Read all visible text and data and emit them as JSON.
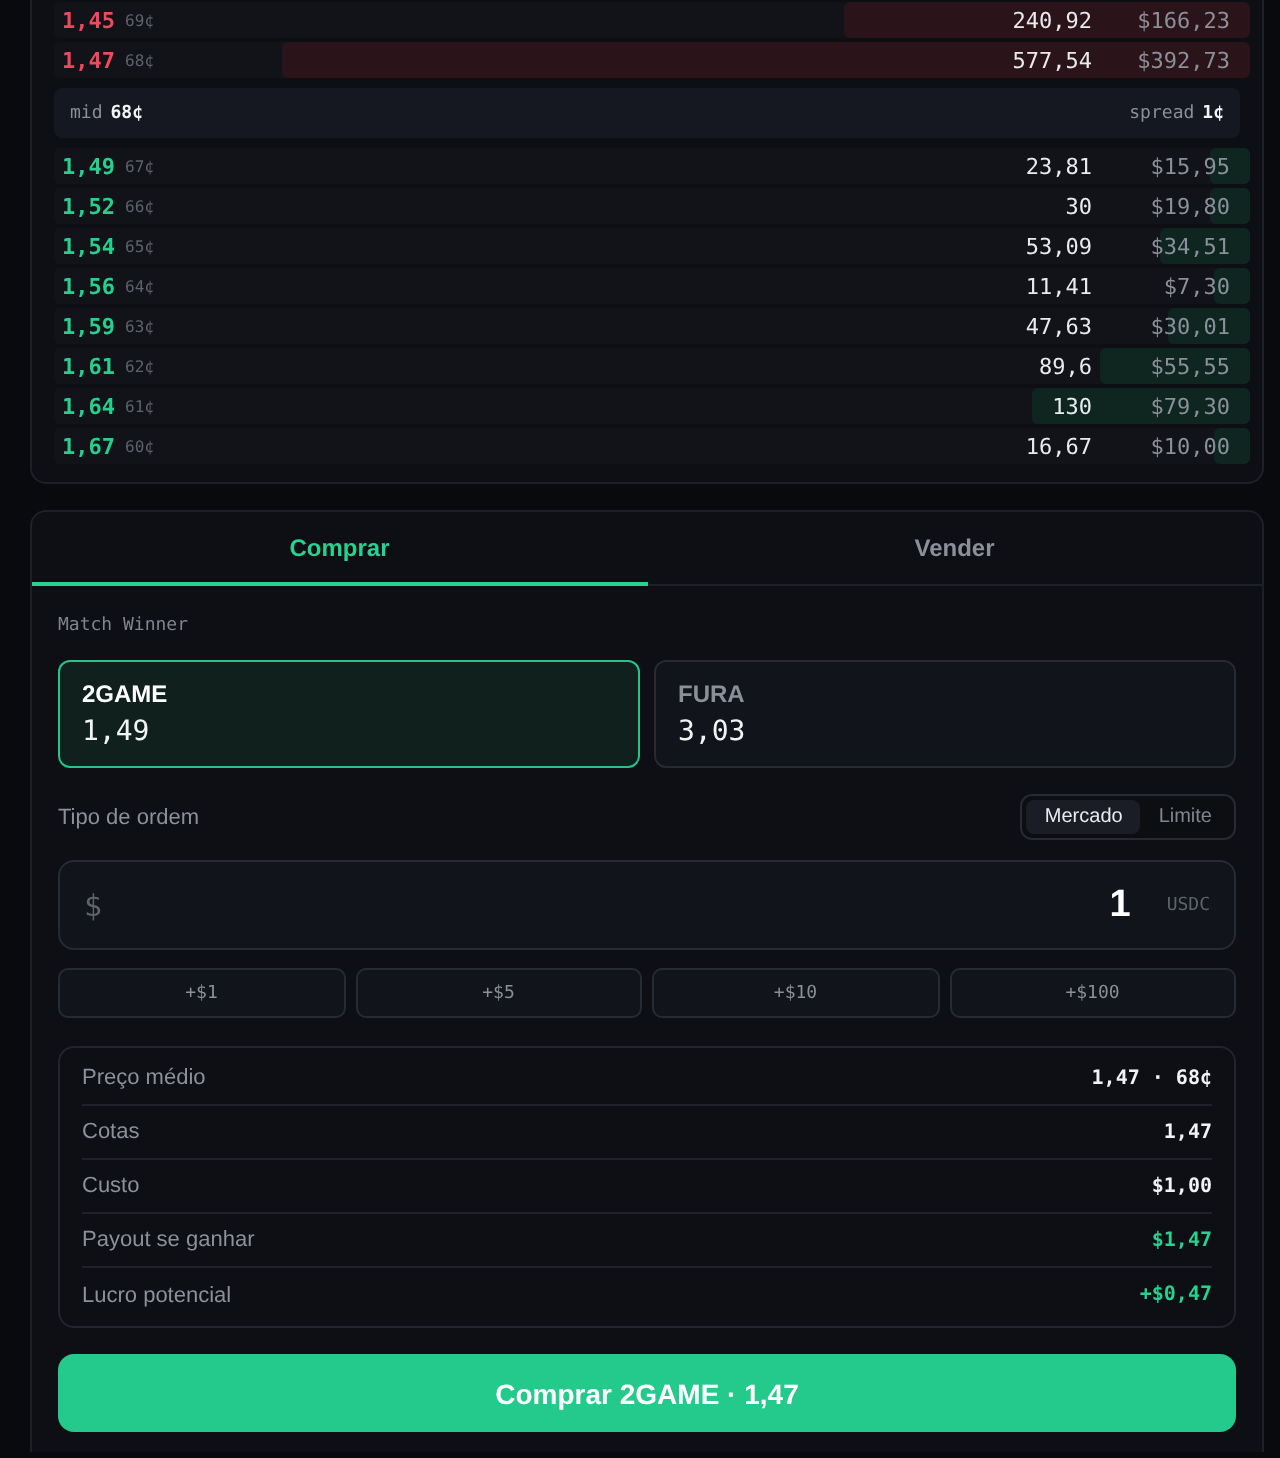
{
  "order_book": {
    "asks": [
      {
        "price": "1,45",
        "cents": "69¢",
        "shares": "240,92",
        "value": "$166,23",
        "level": 0.34
      },
      {
        "price": "1,47",
        "cents": "68¢",
        "shares": "577,54",
        "value": "$392,73",
        "level": 0.81
      }
    ],
    "mid": {
      "label": "mid",
      "value": "68¢"
    },
    "spread": {
      "label": "spread",
      "value": "1¢"
    },
    "bids": [
      {
        "price": "1,49",
        "cents": "67¢",
        "shares": "23,81",
        "value": "$15,95",
        "level": 0.034
      },
      {
        "price": "1,52",
        "cents": "66¢",
        "shares": "30",
        "value": "$19,80",
        "level": 0.034
      },
      {
        "price": "1,54",
        "cents": "65¢",
        "shares": "53,09",
        "value": "$34,51",
        "level": 0.075
      },
      {
        "price": "1,56",
        "cents": "64¢",
        "shares": "11,41",
        "value": "$7,30",
        "level": 0.03
      },
      {
        "price": "1,59",
        "cents": "63¢",
        "shares": "47,63",
        "value": "$30,01",
        "level": 0.069
      },
      {
        "price": "1,61",
        "cents": "62¢",
        "shares": "89,6",
        "value": "$55,55",
        "level": 0.125
      },
      {
        "price": "1,64",
        "cents": "61¢",
        "shares": "130",
        "value": "$79,30",
        "level": 0.182
      },
      {
        "price": "1,67",
        "cents": "60¢",
        "shares": "16,67",
        "value": "$10,00",
        "level": 0.03
      }
    ]
  },
  "trade": {
    "tabs": [
      {
        "label": "Comprar",
        "selected": true
      },
      {
        "label": "Vender",
        "selected": false
      }
    ],
    "market_label": "Match Winner",
    "outcomes": [
      {
        "name": "2GAME",
        "price": "1,49",
        "selected": true
      },
      {
        "name": "FURA",
        "price": "3,03",
        "selected": false
      }
    ],
    "order_type": {
      "label": "Tipo de ordem",
      "options": [
        {
          "label": "Mercado",
          "selected": true
        },
        {
          "label": "Limite",
          "selected": false
        }
      ]
    },
    "amount": {
      "prefix": "$",
      "value": "1",
      "unit": "USDC"
    },
    "quick_amounts": [
      "+$1",
      "+$5",
      "+$10",
      "+$100"
    ],
    "summary": [
      {
        "label": "Preço médio",
        "value": "1,47 · 68¢",
        "positive": false
      },
      {
        "label": "Cotas",
        "value": "1,47",
        "positive": false
      },
      {
        "label": "Custo",
        "value": "$1,00",
        "positive": false
      },
      {
        "label": "Payout se ganhar",
        "value": "$1,47",
        "positive": true
      },
      {
        "label": "Lucro potencial",
        "value": "+$0,47",
        "positive": true
      }
    ],
    "submit": "Comprar 2GAME · 1,47"
  }
}
